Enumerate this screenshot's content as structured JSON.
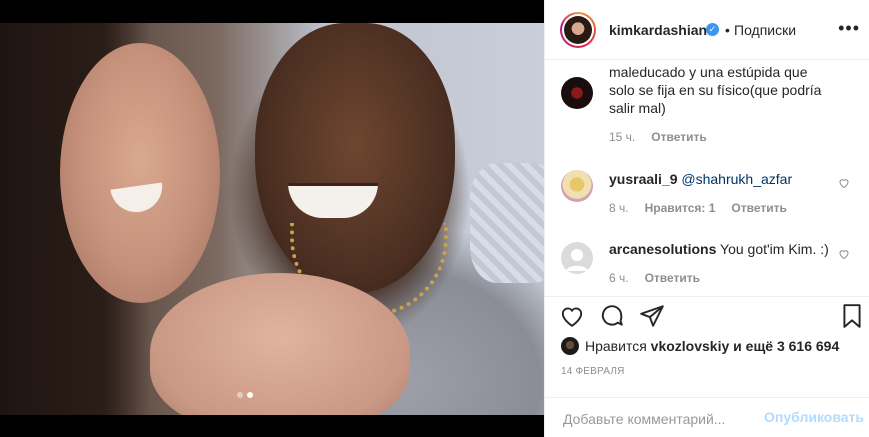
{
  "post_header": {
    "username": "kimkardashian",
    "separator": "•",
    "follow_status": "Подписки",
    "more": "•••"
  },
  "photo": {
    "carousel_dots": 2,
    "active_index": 1
  },
  "comments": [
    {
      "user": "",
      "text": "maleducado y una estúpida que solo se fija en su físico(que podría salir mal)",
      "time": "15 ч.",
      "likes": "",
      "reply": "Ответить"
    },
    {
      "user": "yusraali_9",
      "mention": "@shahrukh_azfar",
      "text": "",
      "time": "8 ч.",
      "likes": "Нравится: 1",
      "reply": "Ответить"
    },
    {
      "user": "arcanesolutions",
      "text": "You got'im Kim. :)",
      "time": "6 ч.",
      "likes": "",
      "reply": "Ответить"
    }
  ],
  "likes": {
    "prefix": "Нравится",
    "user": "vkozlovskiy",
    "suffix": "и ещё 3 616 694"
  },
  "date": "14 ФЕВРАЛЯ",
  "comment_box": {
    "placeholder": "Добавьте комментарий...",
    "publish": "Опубликовать"
  },
  "icons": {
    "like": "heart-icon",
    "comment": "speech-bubble-icon",
    "share": "paper-plane-icon",
    "save": "bookmark-icon",
    "verified": "verified-badge-icon"
  },
  "colors": {
    "verified": "#3897f0",
    "publish_disabled": "#b3dbff",
    "mention": "#003569",
    "muted": "#8e8e8e"
  }
}
